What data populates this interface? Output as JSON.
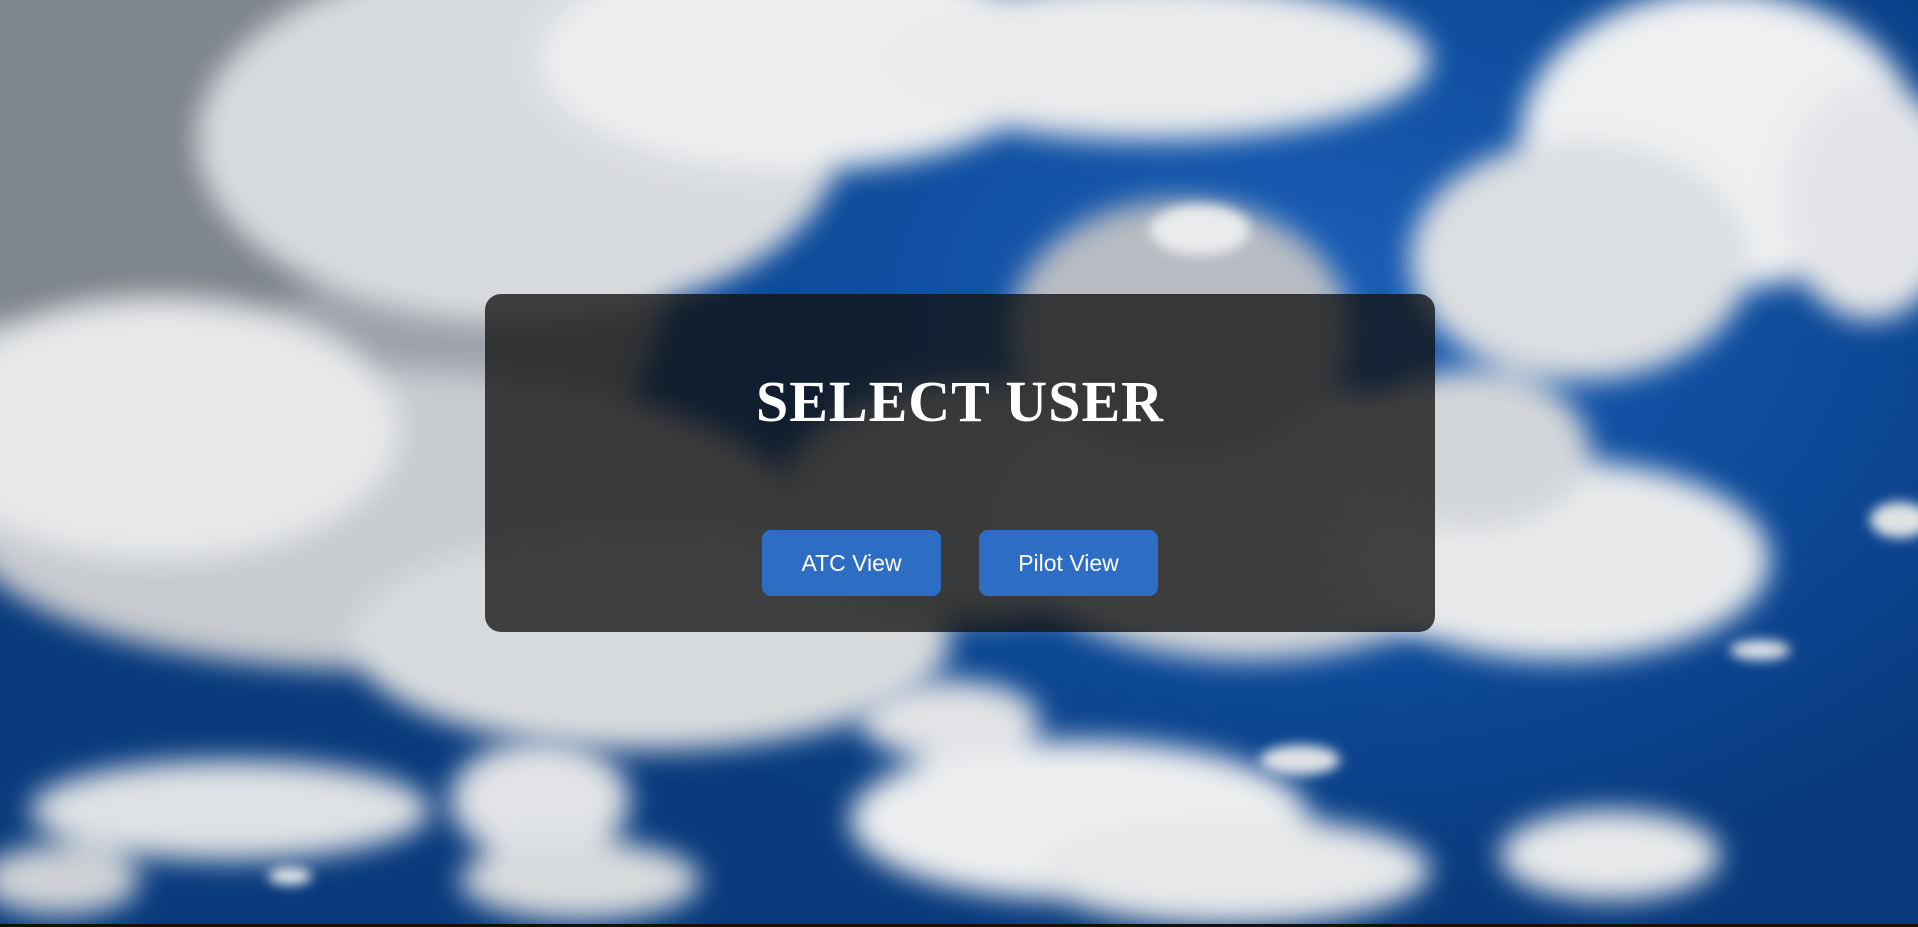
{
  "dialog": {
    "title": "SELECT USER",
    "buttons": {
      "atc_label": "ATC View",
      "pilot_label": "Pilot View"
    }
  },
  "colors": {
    "sky_blue": "#0b4fa3",
    "panel_overlay": "#121212",
    "button_blue": "#2d6ec4",
    "text": "#ffffff"
  }
}
